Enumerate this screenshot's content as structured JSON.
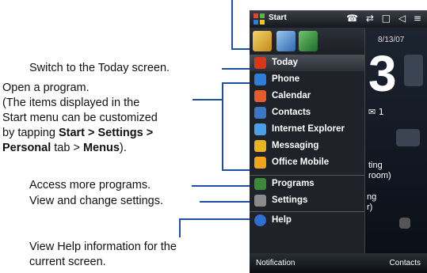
{
  "annotations": {
    "today": "Switch to the Today screen.",
    "open_line1": "Open a program.",
    "open_line2": "(The items displayed in the",
    "open_line3": "Start menu can be customized",
    "open_line4a": "by tapping ",
    "open_line4b": "Start > Settings >",
    "open_line5a": "Personal",
    "open_line5b": " tab > ",
    "open_line5c": "Menus",
    "open_line5d": ").",
    "programs": "Access more programs.",
    "settings": "View and change settings.",
    "help_line1": "View Help information for the",
    "help_line2": "current screen."
  },
  "phone": {
    "title": "Start",
    "status_icons": "☎ ⇄ □ ◁ ≡",
    "date": "8/13/07",
    "big_number": "3",
    "message_count": "✉ 1",
    "appointment_l1": "ting",
    "appointment_l2": "room)",
    "tag_l1": "ng",
    "tag_l2": "r)",
    "menu_items": [
      {
        "label": "Today",
        "icon": "today-icon",
        "color": "#d9361b"
      },
      {
        "label": "Phone",
        "icon": "phone-icon",
        "color": "#2d7ed8"
      },
      {
        "label": "Calendar",
        "icon": "calendar-icon",
        "color": "#e45c2b"
      },
      {
        "label": "Contacts",
        "icon": "contacts-icon",
        "color": "#3b77c4"
      },
      {
        "label": "Internet Explorer",
        "icon": "internet-explorer-icon",
        "color": "#4aa0e6"
      },
      {
        "label": "Messaging",
        "icon": "messaging-icon",
        "color": "#e7b521"
      },
      {
        "label": "Office Mobile",
        "icon": "office-mobile-icon",
        "color": "#f0a41c"
      },
      {
        "label": "Programs",
        "icon": "programs-icon",
        "color": "#3a8a3a"
      },
      {
        "label": "Settings",
        "icon": "settings-icon",
        "color": "#8a8a8a"
      },
      {
        "label": "Help",
        "icon": "help-icon",
        "color": "#2f6fd1"
      }
    ],
    "softkey_left": "Notification",
    "softkey_right": "Contacts"
  }
}
